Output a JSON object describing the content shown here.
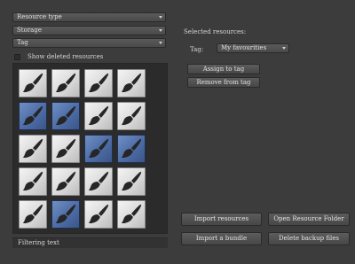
{
  "filters": {
    "resource_type": "Resource type",
    "storage": "Storage",
    "tag": "Tag"
  },
  "show_deleted": {
    "label": "Show deleted resources",
    "checked": false
  },
  "resources": {
    "tiles": [
      {
        "icon": "brush-icon",
        "selected": false
      },
      {
        "icon": "brush-icon",
        "selected": false
      },
      {
        "icon": "brush-icon",
        "selected": false
      },
      {
        "icon": "brush-icon",
        "selected": false
      },
      {
        "icon": "brush-icon",
        "selected": true
      },
      {
        "icon": "brush-icon",
        "selected": true
      },
      {
        "icon": "brush-icon",
        "selected": false
      },
      {
        "icon": "brush-icon",
        "selected": false
      },
      {
        "icon": "brush-icon",
        "selected": false
      },
      {
        "icon": "brush-icon",
        "selected": false
      },
      {
        "icon": "brush-icon",
        "selected": true
      },
      {
        "icon": "brush-icon",
        "selected": true
      },
      {
        "icon": "brush-icon",
        "selected": false
      },
      {
        "icon": "brush-icon",
        "selected": false
      },
      {
        "icon": "brush-icon",
        "selected": false
      },
      {
        "icon": "brush-icon",
        "selected": false
      },
      {
        "icon": "brush-icon",
        "selected": false
      },
      {
        "icon": "brush-icon",
        "selected": true
      },
      {
        "icon": "brush-icon",
        "selected": false
      },
      {
        "icon": "brush-icon",
        "selected": false
      }
    ],
    "selected_color": "#4d6ca6"
  },
  "filter_text": {
    "placeholder": "Filtering text"
  },
  "selected_panel": {
    "heading": "Selected resources:",
    "tag_label": "Tag:",
    "tag_value": "My favourities",
    "assign_label": "Assign to tag",
    "remove_label": "Remove from tag"
  },
  "actions": {
    "import_resources": "Import resources",
    "open_folder": "Open Resource Folder",
    "import_bundle": "Import a bundle",
    "delete_backup": "Delete backup files"
  }
}
